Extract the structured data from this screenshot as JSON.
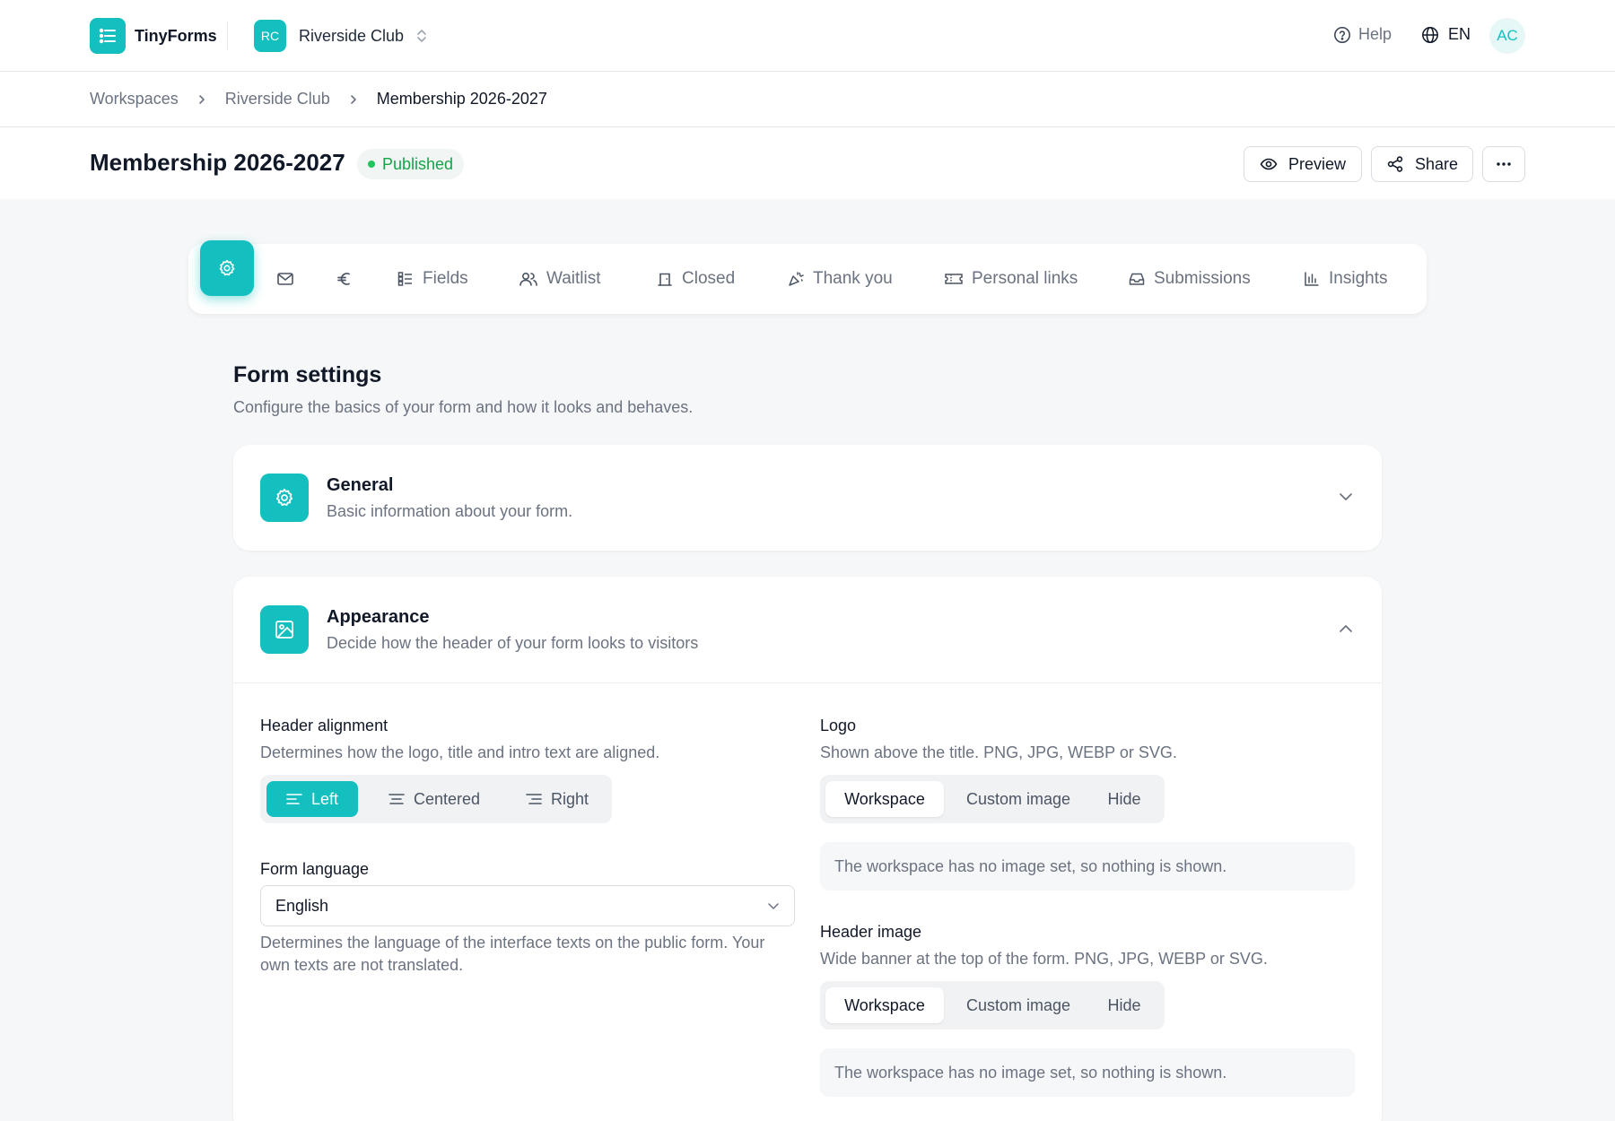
{
  "app": {
    "name": "TinyForms"
  },
  "workspace": {
    "initials": "RC",
    "name": "Riverside Club"
  },
  "header": {
    "help_label": "Help",
    "lang_label": "EN",
    "avatar_initials": "AC"
  },
  "breadcrumb": [
    "Workspaces",
    "Riverside Club",
    "Membership 2026-2027"
  ],
  "page": {
    "title": "Membership 2026-2027",
    "status": "Published",
    "status_color": "#16a34a",
    "actions": {
      "preview": "Preview",
      "share": "Share"
    }
  },
  "tabs": [
    {
      "label": "",
      "icon": "gear-icon",
      "active": true
    },
    {
      "label": "",
      "icon": "mail-icon"
    },
    {
      "label": "",
      "icon": "euro-icon"
    },
    {
      "label": "Fields",
      "icon": "fields-icon"
    },
    {
      "label": "Waitlist",
      "icon": "users-icon"
    },
    {
      "label": "Closed",
      "icon": "closed-icon"
    },
    {
      "label": "Thank you",
      "icon": "party-icon"
    },
    {
      "label": "Personal links",
      "icon": "ticket-icon"
    },
    {
      "label": "Submissions",
      "icon": "inbox-icon"
    },
    {
      "label": "Insights",
      "icon": "chart-icon"
    }
  ],
  "settings": {
    "title": "Form settings",
    "subtitle": "Configure the basics of your form and how it looks and behaves."
  },
  "general": {
    "title": "General",
    "description": "Basic information about your form.",
    "expanded": false
  },
  "appearance": {
    "title": "Appearance",
    "description": "Decide how the header of your form looks to visitors",
    "expanded": true,
    "header_alignment": {
      "label": "Header alignment",
      "help": "Determines how the logo, title and intro text are aligned.",
      "options": [
        "Left",
        "Centered",
        "Right"
      ],
      "selected": "Left"
    },
    "form_language": {
      "label": "Form language",
      "value": "English",
      "help": "Determines the language of the interface texts on the public form. Your own texts are not translated."
    },
    "logo": {
      "label": "Logo",
      "help": "Shown above the title. PNG, JPG, WEBP or SVG.",
      "options": [
        "Workspace",
        "Custom image",
        "Hide"
      ],
      "selected": "Workspace",
      "note": "The workspace has no image set, so nothing is shown."
    },
    "header_image": {
      "label": "Header image",
      "help": "Wide banner at the top of the form. PNG, JPG, WEBP or SVG.",
      "options": [
        "Workspace",
        "Custom image",
        "Hide"
      ],
      "selected": "Workspace",
      "note": "The workspace has no image set, so nothing is shown."
    }
  },
  "colors": {
    "accent": "#14bfbf",
    "status_green": "#22c55e"
  }
}
